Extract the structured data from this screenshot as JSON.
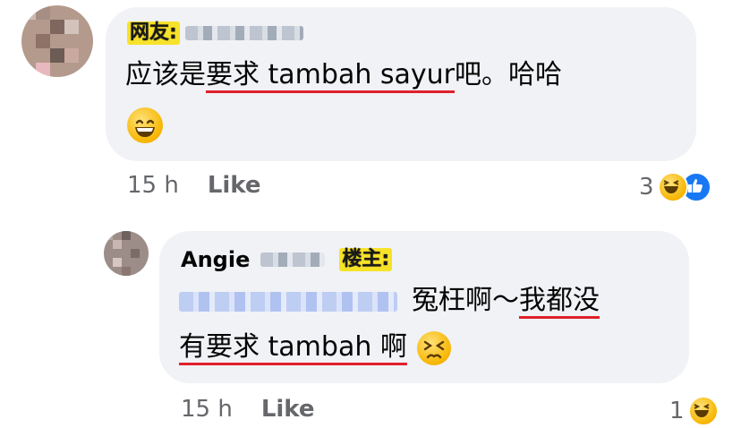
{
  "comment1": {
    "tag": "网友:",
    "text_before": "应该是",
    "text_underlined": "要求 tambah sayur",
    "text_after": "吧。哈哈",
    "emoji": "grinning-face-emoji",
    "time": "15 h",
    "like_label": "Like",
    "reaction_count": "3",
    "reactions": [
      "haha-icon",
      "thumbs-up-icon"
    ]
  },
  "comment2": {
    "author_first": "Angie",
    "tag": "楼主:",
    "text_line1_plain": "冤枉啊～",
    "text_line1_underlined": "我都没",
    "text_line2_underlined": "有要求 tambah 啊",
    "emoji": "persevering-face-emoji",
    "time": "15 h",
    "like_label": "Like",
    "reaction_count": "1",
    "reactions": [
      "haha-icon"
    ]
  },
  "colors": {
    "bubble_bg": "#f0f2f5",
    "tag_bg": "#f7e22a",
    "underline": "#e0202a",
    "meta_text": "#65676b",
    "like_blue": "#1877f2"
  }
}
